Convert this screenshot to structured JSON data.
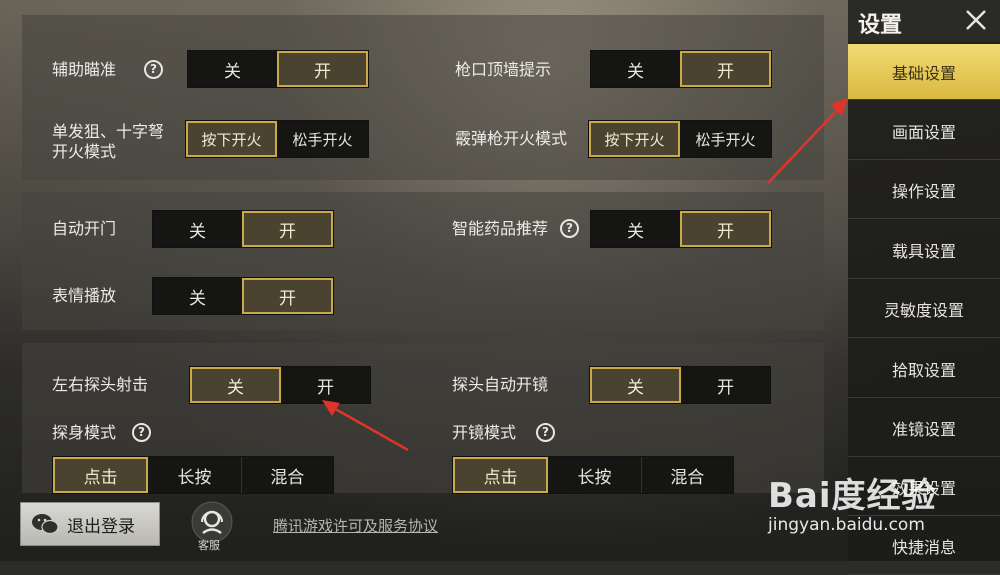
{
  "sidebar": {
    "title": "设置",
    "items": [
      {
        "label": "基础设置",
        "active": true
      },
      {
        "label": "画面设置"
      },
      {
        "label": "操作设置"
      },
      {
        "label": "载具设置"
      },
      {
        "label": "灵敏度设置"
      },
      {
        "label": "拾取设置"
      },
      {
        "label": "准镜设置"
      },
      {
        "label": "效果设置"
      },
      {
        "label": "快捷消息"
      }
    ]
  },
  "settings": {
    "aim_assist": {
      "label": "辅助瞄准",
      "off": "关",
      "on": "开",
      "selected": "on"
    },
    "muzzle_hint": {
      "label": "枪口顶墙提示",
      "off": "关",
      "on": "开",
      "selected": "on"
    },
    "single_fire": {
      "label_line1": "单发狙、十字弩",
      "label_line2": "开火模式",
      "press": "按下开火",
      "release": "松手开火",
      "selected": "press"
    },
    "shotgun_fire": {
      "label": "霰弹枪开火模式",
      "press": "按下开火",
      "release": "松手开火",
      "selected": "press"
    },
    "auto_door": {
      "label": "自动开门",
      "off": "关",
      "on": "开",
      "selected": "on"
    },
    "med_recommend": {
      "label": "智能药品推荐",
      "off": "关",
      "on": "开",
      "selected": "on"
    },
    "emote_play": {
      "label": "表情播放",
      "off": "关",
      "on": "开",
      "selected": "on"
    },
    "peek_fire": {
      "label": "左右探头射击",
      "off": "关",
      "on": "开",
      "selected": "off"
    },
    "peek_scope": {
      "label": "探头自动开镜",
      "off": "关",
      "on": "开",
      "selected": "off"
    },
    "peek_mode": {
      "label": "探身模式",
      "opts": [
        "点击",
        "长按",
        "混合"
      ],
      "selected": 0
    },
    "scope_mode": {
      "label": "开镜模式",
      "opts": [
        "点击",
        "长按",
        "混合"
      ],
      "selected": 0
    }
  },
  "help_glyph": "?",
  "bottom": {
    "logout_label": "退出登录",
    "cs_label": "客服",
    "license_link": "腾讯游戏许可及服务协议"
  },
  "watermark": {
    "logo": "Bai度经验",
    "url": "jingyan.baidu.com"
  },
  "colors": {
    "accent": "#c9a94a",
    "active_tab": "#e6c95a"
  }
}
